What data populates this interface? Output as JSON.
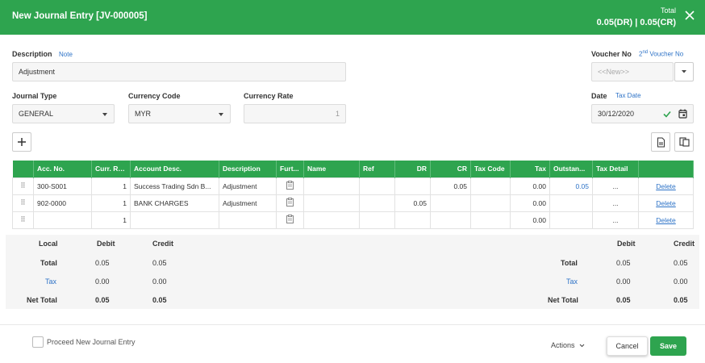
{
  "header": {
    "title": "New Journal Entry [JV-000005]",
    "total_label": "Total",
    "total_value": "0.05(DR) | 0.05(CR)"
  },
  "form": {
    "description_label": "Description",
    "note_link": "Note",
    "description_value": "Adjustment",
    "voucher_no_label": "Voucher No",
    "second_voucher_prefix": "2",
    "second_voucher_sup": "nd",
    "second_voucher_suffix": " Voucher No",
    "voucher_placeholder": "<<New>>",
    "journal_type_label": "Journal Type",
    "journal_type_value": "GENERAL",
    "currency_code_label": "Currency Code",
    "currency_code_value": "MYR",
    "currency_rate_label": "Currency Rate",
    "currency_rate_value": "1",
    "date_label": "Date",
    "tax_date_link": "Tax Date",
    "date_value": "30/12/2020"
  },
  "grid": {
    "columns": [
      "",
      "Acc. No.",
      "Curr. Ra...",
      "Account Desc.",
      "Description",
      "Furt...",
      "Name",
      "Ref",
      "DR",
      "CR",
      "Tax Code",
      "Tax",
      "Outstan...",
      "Tax Detail",
      ""
    ],
    "rows": [
      {
        "acc": "300-S001",
        "rate": "1",
        "acc_desc": "Success Trading Sdn B...",
        "desc": "Adjustment",
        "name": "",
        "ref": "",
        "dr": "",
        "cr": "0.05",
        "tax_code": "",
        "tax": "0.00",
        "outstanding": "0.05",
        "tax_detail": "...",
        "action": "Delete"
      },
      {
        "acc": "902-0000",
        "rate": "1",
        "acc_desc": "BANK CHARGES",
        "desc": "Adjustment",
        "name": "",
        "ref": "",
        "dr": "0.05",
        "cr": "",
        "tax_code": "",
        "tax": "0.00",
        "outstanding": "",
        "tax_detail": "...",
        "action": "Delete"
      },
      {
        "acc": "",
        "rate": "1",
        "acc_desc": "",
        "desc": "",
        "name": "",
        "ref": "",
        "dr": "",
        "cr": "",
        "tax_code": "",
        "tax": "0.00",
        "outstanding": "",
        "tax_detail": "...",
        "action": "Delete"
      }
    ]
  },
  "summary": {
    "local_label": "Local",
    "debit_label": "Debit",
    "credit_label": "Credit",
    "total_label": "Total",
    "tax_label": "Tax",
    "net_total_label": "Net Total",
    "local": {
      "total_debit": "0.05",
      "total_credit": "0.05",
      "tax_debit": "0.00",
      "tax_credit": "0.00",
      "net_debit": "0.05",
      "net_credit": "0.05"
    },
    "right": {
      "total_debit": "0.05",
      "total_credit": "0.05",
      "tax_debit": "0.00",
      "tax_credit": "0.00",
      "net_debit": "0.05",
      "net_credit": "0.05"
    }
  },
  "footer": {
    "proceed_label": "Proceed New Journal Entry",
    "actions_label": "Actions",
    "cancel_label": "Cancel",
    "save_label": "Save"
  },
  "colors": {
    "brand": "#2ea44f",
    "link": "#2e73c7"
  }
}
